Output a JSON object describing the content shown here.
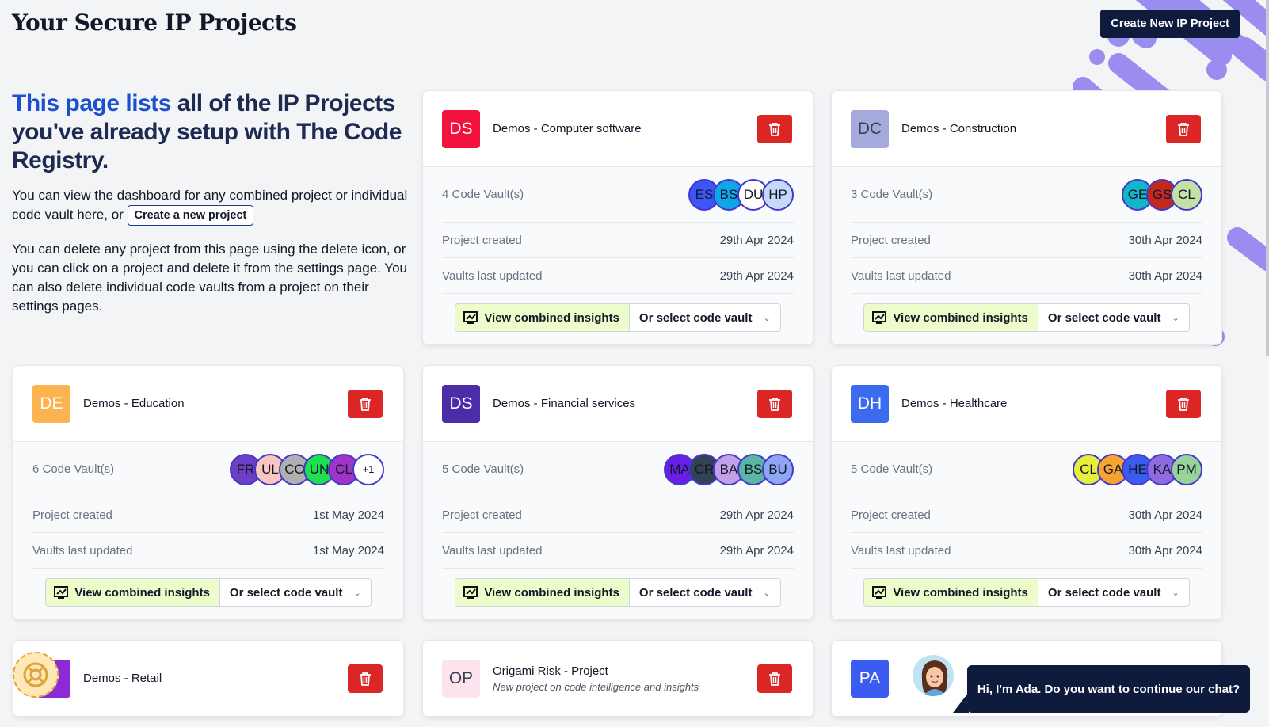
{
  "page": {
    "title": "Your Secure IP Projects",
    "create_button": "Create New IP Project"
  },
  "intro": {
    "heading_highlight": "This page lists",
    "heading_rest": " all of the IP Projects you've already setup with The Code Registry.",
    "para1_text": "You can view the dashboard for any combined project or individual code vault here, or ",
    "para1_button": "Create a new project",
    "para2": "You can delete any project from this page using the delete icon, or you can click on a project and delete it from the settings page. You can also delete individual code vaults from a project on their settings pages."
  },
  "labels": {
    "project_created": "Project created",
    "vaults_last_updated": "Vaults last updated",
    "view_insights": "View combined insights",
    "select_vault": "Or select code vault"
  },
  "colors": {
    "delete": "#dc2626",
    "navy": "#0f1b3d",
    "accent": "#1d4fd1",
    "decor": "#9b8cf0"
  },
  "projects": [
    {
      "initials": "DS",
      "avatar_color": "#f3123d",
      "name": "Demos - Computer software",
      "vaults": "4 Code Vault(s)",
      "created": "29th Apr 2024",
      "updated": "29th Apr 2024",
      "vault_avatars": [
        {
          "text": "ES",
          "color": "#3b55f7"
        },
        {
          "text": "BS",
          "color": "#0ea5e9"
        },
        {
          "text": "DU",
          "color": "#ffffff"
        },
        {
          "text": "HP",
          "color": "#c7d9f8"
        }
      ]
    },
    {
      "initials": "DC",
      "avatar_color": "#a5a9dc",
      "name": "Demos - Construction",
      "vaults": "3 Code Vault(s)",
      "created": "30th Apr 2024",
      "updated": "30th Apr 2024",
      "vault_avatars": [
        {
          "text": "GE",
          "color": "#12b5c9"
        },
        {
          "text": "GS",
          "color": "#c2281d"
        },
        {
          "text": "CL",
          "color": "#c5e1a5"
        }
      ]
    },
    {
      "initials": "DE",
      "avatar_color": "#fbb450",
      "name": "Demos - Education",
      "vaults": "6 Code Vault(s)",
      "created": "1st May 2024",
      "updated": "1st May 2024",
      "vault_avatars": [
        {
          "text": "FR",
          "color": "#6d3fc4"
        },
        {
          "text": "UL",
          "color": "#f9c6c0"
        },
        {
          "text": "CO",
          "color": "#b0b0b0"
        },
        {
          "text": "UN",
          "color": "#1ddf4f"
        },
        {
          "text": "CL",
          "color": "#9f34c9"
        }
      ],
      "extra": "+1"
    },
    {
      "initials": "DS",
      "avatar_color": "#4c2ca7",
      "name": "Demos - Financial services",
      "vaults": "5 Code Vault(s)",
      "created": "29th Apr 2024",
      "updated": "29th Apr 2024",
      "vault_avatars": [
        {
          "text": "MA",
          "color": "#6a1ee8"
        },
        {
          "text": "CR",
          "color": "#334155"
        },
        {
          "text": "BA",
          "color": "#c4a0e8"
        },
        {
          "text": "BS",
          "color": "#5ab5a3"
        },
        {
          "text": "BU",
          "color": "#8fa6f5"
        }
      ]
    },
    {
      "initials": "DH",
      "avatar_color": "#3b6cf0",
      "name": "Demos - Healthcare",
      "vaults": "5 Code Vault(s)",
      "created": "30th Apr 2024",
      "updated": "30th Apr 2024",
      "vault_avatars": [
        {
          "text": "CL",
          "color": "#e6f03a"
        },
        {
          "text": "GA",
          "color": "#f6a430"
        },
        {
          "text": "HE",
          "color": "#3b5cf0"
        },
        {
          "text": "KA",
          "color": "#8e6ce0"
        },
        {
          "text": "PM",
          "color": "#98d49a"
        }
      ]
    },
    {
      "initials": "R",
      "avatar_color": "#8b2ad6",
      "name": "Demos - Retail"
    },
    {
      "initials": "OP",
      "avatar_color": "#fde4ec",
      "name": "Origami Risk - Project",
      "description": "New project on code intelligence and insights"
    },
    {
      "initials": "PA",
      "avatar_color": "#3b5cf0",
      "name": ""
    }
  ],
  "chat": {
    "message": "Hi, I'm Ada. Do you want to continue our chat?"
  }
}
